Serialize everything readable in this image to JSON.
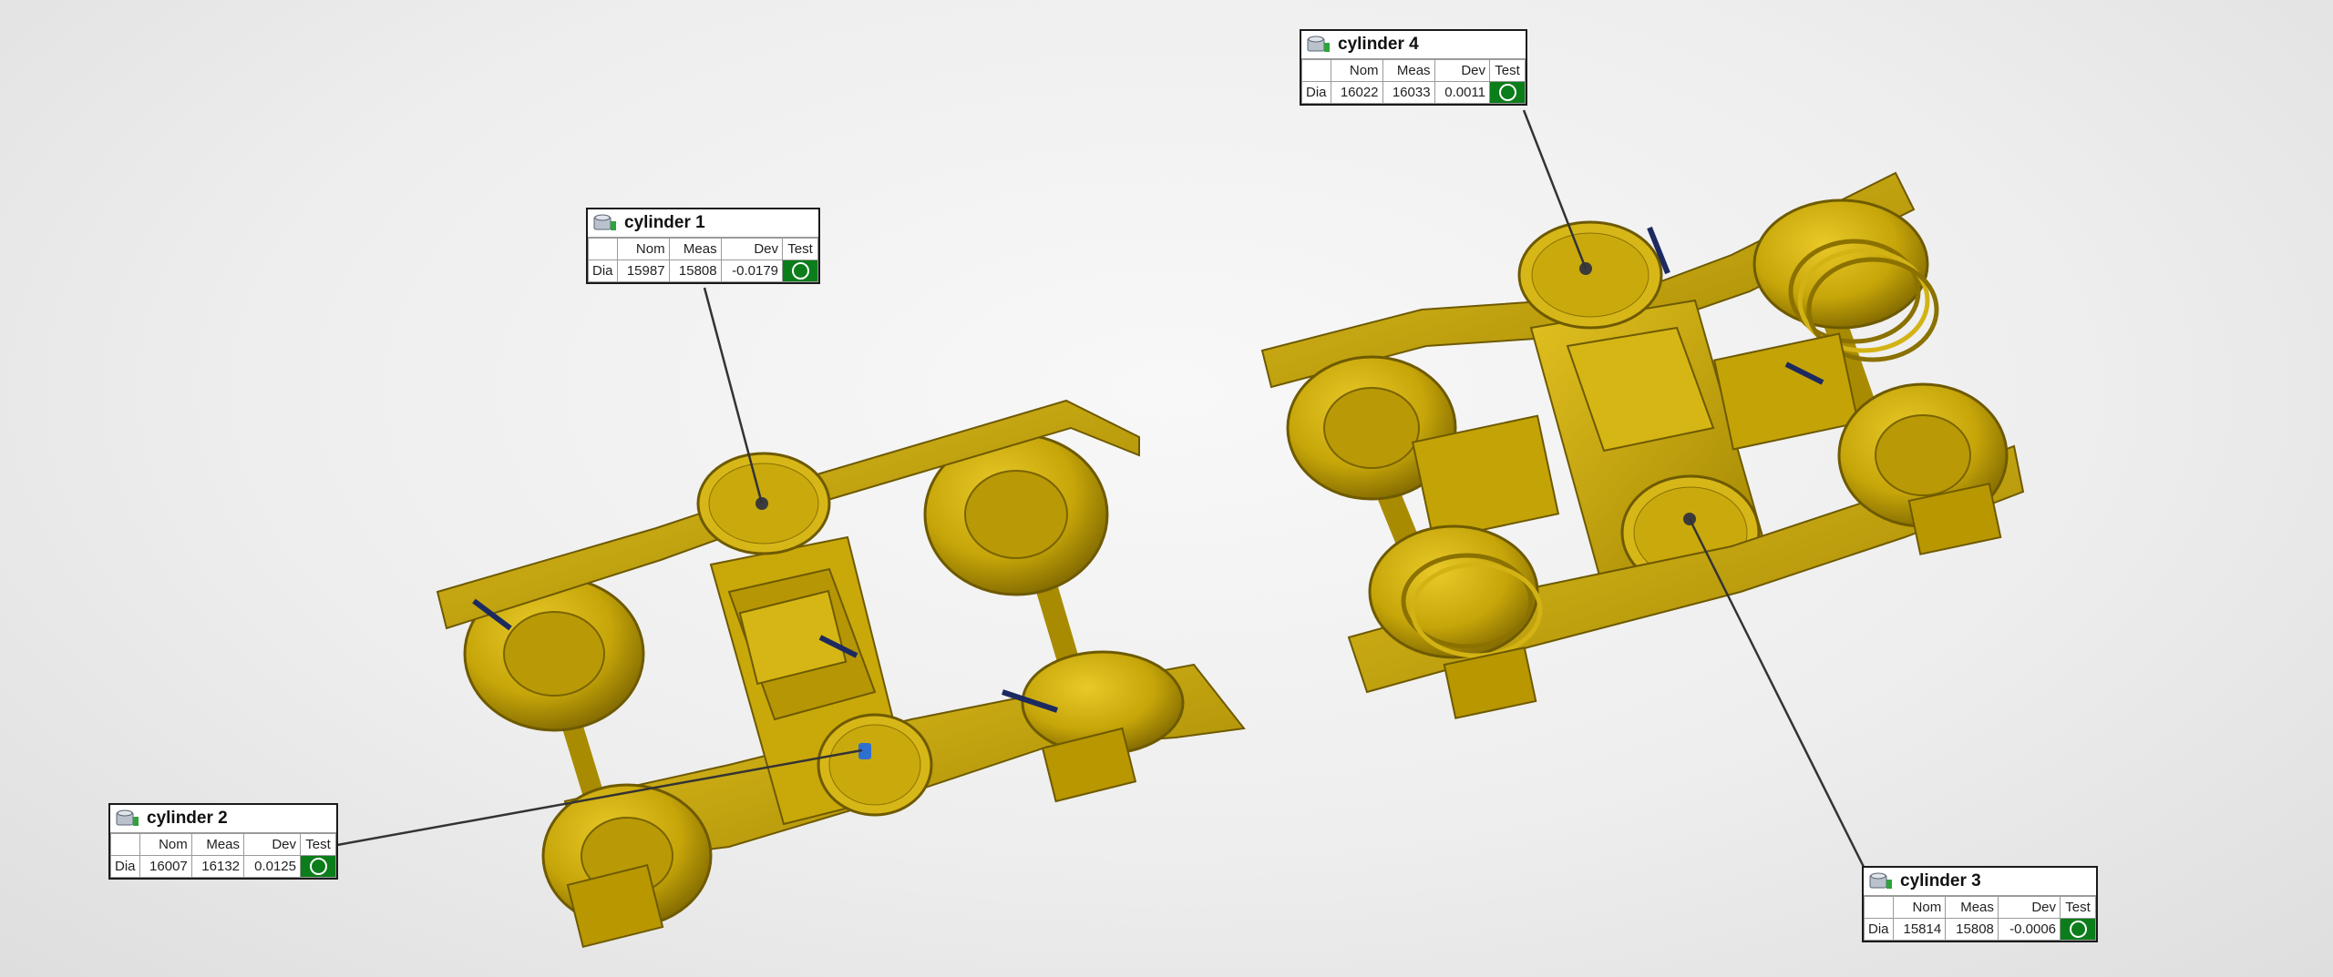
{
  "theme": {
    "model_body": "#c9a80a",
    "model_shade": "#8a7100",
    "model_light": "#e6c52a",
    "pass_color": "#0b7d1a",
    "leader_color": "#333333"
  },
  "columns": {
    "nom": "Nom",
    "meas": "Meas",
    "dev": "Dev",
    "test": "Test"
  },
  "labels": [
    {
      "id": "cylinder-1",
      "title": "cylinder 1",
      "row": "Dia",
      "nom": "15987",
      "meas": "15808",
      "dev": "-0.0179",
      "test_status": "pass",
      "icon": "cylinder-feature-icon"
    },
    {
      "id": "cylinder-2",
      "title": "cylinder 2",
      "row": "Dia",
      "nom": "16007",
      "meas": "16132",
      "dev": "0.0125",
      "test_status": "pass",
      "icon": "cylinder-feature-icon"
    },
    {
      "id": "cylinder-3",
      "title": "cylinder 3",
      "row": "Dia",
      "nom": "15814",
      "meas": "15808",
      "dev": "-0.0006",
      "test_status": "pass",
      "icon": "cylinder-feature-icon"
    },
    {
      "id": "cylinder-4",
      "title": "cylinder 4",
      "row": "Dia",
      "nom": "16022",
      "meas": "16033",
      "dev": "0.0011",
      "test_status": "pass",
      "icon": "cylinder-feature-icon"
    }
  ]
}
